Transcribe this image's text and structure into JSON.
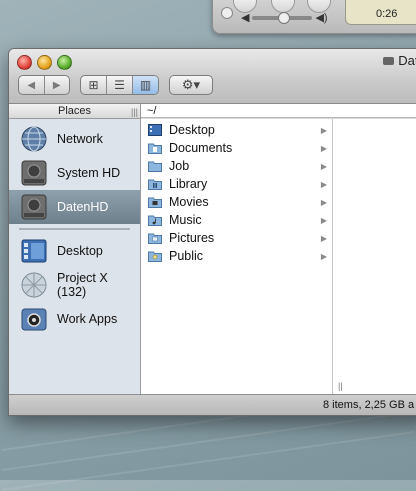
{
  "player": {
    "time": "0:26"
  },
  "window": {
    "title": "Daten"
  },
  "toolbar": {
    "back_label": "◀",
    "forward_label": "▶",
    "view_icons": "⊞",
    "view_list": "☰",
    "view_columns": "▥",
    "action_label": "⚙▾"
  },
  "sidebar": {
    "header": "Places",
    "devices": [
      {
        "label": "Network",
        "icon": "network-globe-icon"
      },
      {
        "label": "System HD",
        "icon": "hard-drive-icon"
      },
      {
        "label": "DatenHD",
        "icon": "hard-drive-icon",
        "selected": true
      }
    ],
    "places": [
      {
        "label": "Desktop",
        "icon": "desktop-icon"
      },
      {
        "label": "Project X (132)",
        "icon": "burn-folder-icon"
      },
      {
        "label": "Work Apps",
        "icon": "applications-folder-icon"
      }
    ]
  },
  "path": "~/",
  "files": [
    {
      "name": "Desktop",
      "icon": "desktop-folder-icon"
    },
    {
      "name": "Documents",
      "icon": "documents-folder-icon"
    },
    {
      "name": "Job",
      "icon": "folder-icon"
    },
    {
      "name": "Library",
      "icon": "library-folder-icon"
    },
    {
      "name": "Movies",
      "icon": "movies-folder-icon"
    },
    {
      "name": "Music",
      "icon": "music-folder-icon"
    },
    {
      "name": "Pictures",
      "icon": "pictures-folder-icon"
    },
    {
      "name": "Public",
      "icon": "public-folder-icon"
    }
  ],
  "status": "8 items, 2,25 GB a",
  "colors": {
    "sidebar_bg": "#dde3ea",
    "selection": "#7a8b98",
    "folder_blue": "#7da9d6"
  }
}
